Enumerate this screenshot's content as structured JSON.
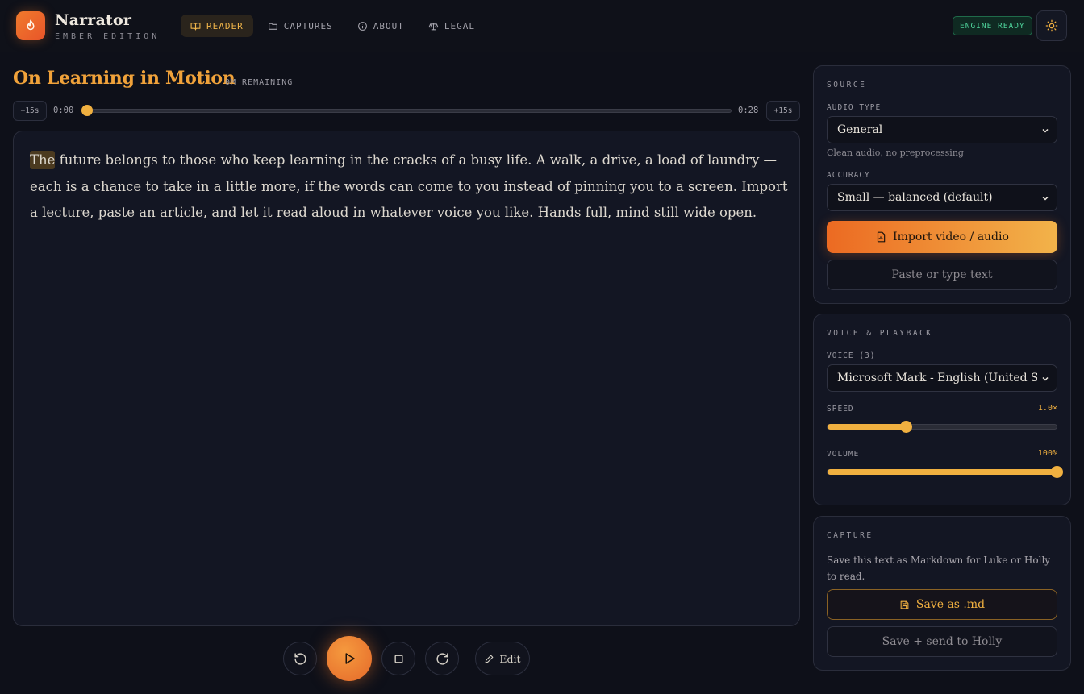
{
  "app": {
    "name": "Narrator",
    "edition": "EMBER EDITION",
    "engine_status": "ENGINE READY"
  },
  "nav": {
    "items": [
      {
        "label": "READER",
        "icon": "book-open-icon",
        "active": true
      },
      {
        "label": "CAPTURES",
        "icon": "folder-icon",
        "active": false
      },
      {
        "label": "ABOUT",
        "icon": "info-icon",
        "active": false
      },
      {
        "label": "LEGAL",
        "icon": "scale-icon",
        "active": false
      }
    ]
  },
  "document": {
    "title": "On Learning in Motion",
    "remaining": "0M REMAINING",
    "highlighted_word": "The",
    "text": " future belongs to those who keep learning in the cracks of a busy life. A walk, a drive, a load of laundry — each is a chance to take in a little more, if the words can come to you instead of pinning you to a screen. Import a lecture, paste an article, and let it read aloud in whatever voice you like. Hands full, mind still wide open."
  },
  "scrubber": {
    "back_label": "−15s",
    "forward_label": "+15s",
    "current_time": "0:00",
    "total_time": "0:28",
    "progress": 0.0
  },
  "controls": {
    "edit_label": "Edit"
  },
  "source_panel": {
    "title": "SOURCE",
    "audio_type_label": "AUDIO TYPE",
    "audio_type_value": "General",
    "audio_type_hint": "Clean audio, no preprocessing",
    "accuracy_label": "ACCURACY",
    "accuracy_value": "Small — balanced (default)",
    "import_label": "Import video / audio",
    "paste_label": "Paste or type text"
  },
  "voice_panel": {
    "title": "VOICE & PLAYBACK",
    "voice_label": "VOICE (3)",
    "voice_value": "Microsoft Mark - English (United States)",
    "speed_label": "SPEED",
    "speed_value": "1.0×",
    "speed_fraction": 0.34,
    "volume_label": "VOLUME",
    "volume_value": "100%",
    "volume_fraction": 1.0
  },
  "capture_panel": {
    "title": "CAPTURE",
    "description": "Save this text as Markdown for Luke or Holly to read.",
    "save_label": "Save as .md",
    "send_label": "Save + send to Holly"
  },
  "colors": {
    "accent": "#f0b040",
    "accent_orange": "#ec6a22",
    "title": "#f0a23a",
    "status_green": "#4ed29a",
    "background": "#0e1019"
  }
}
